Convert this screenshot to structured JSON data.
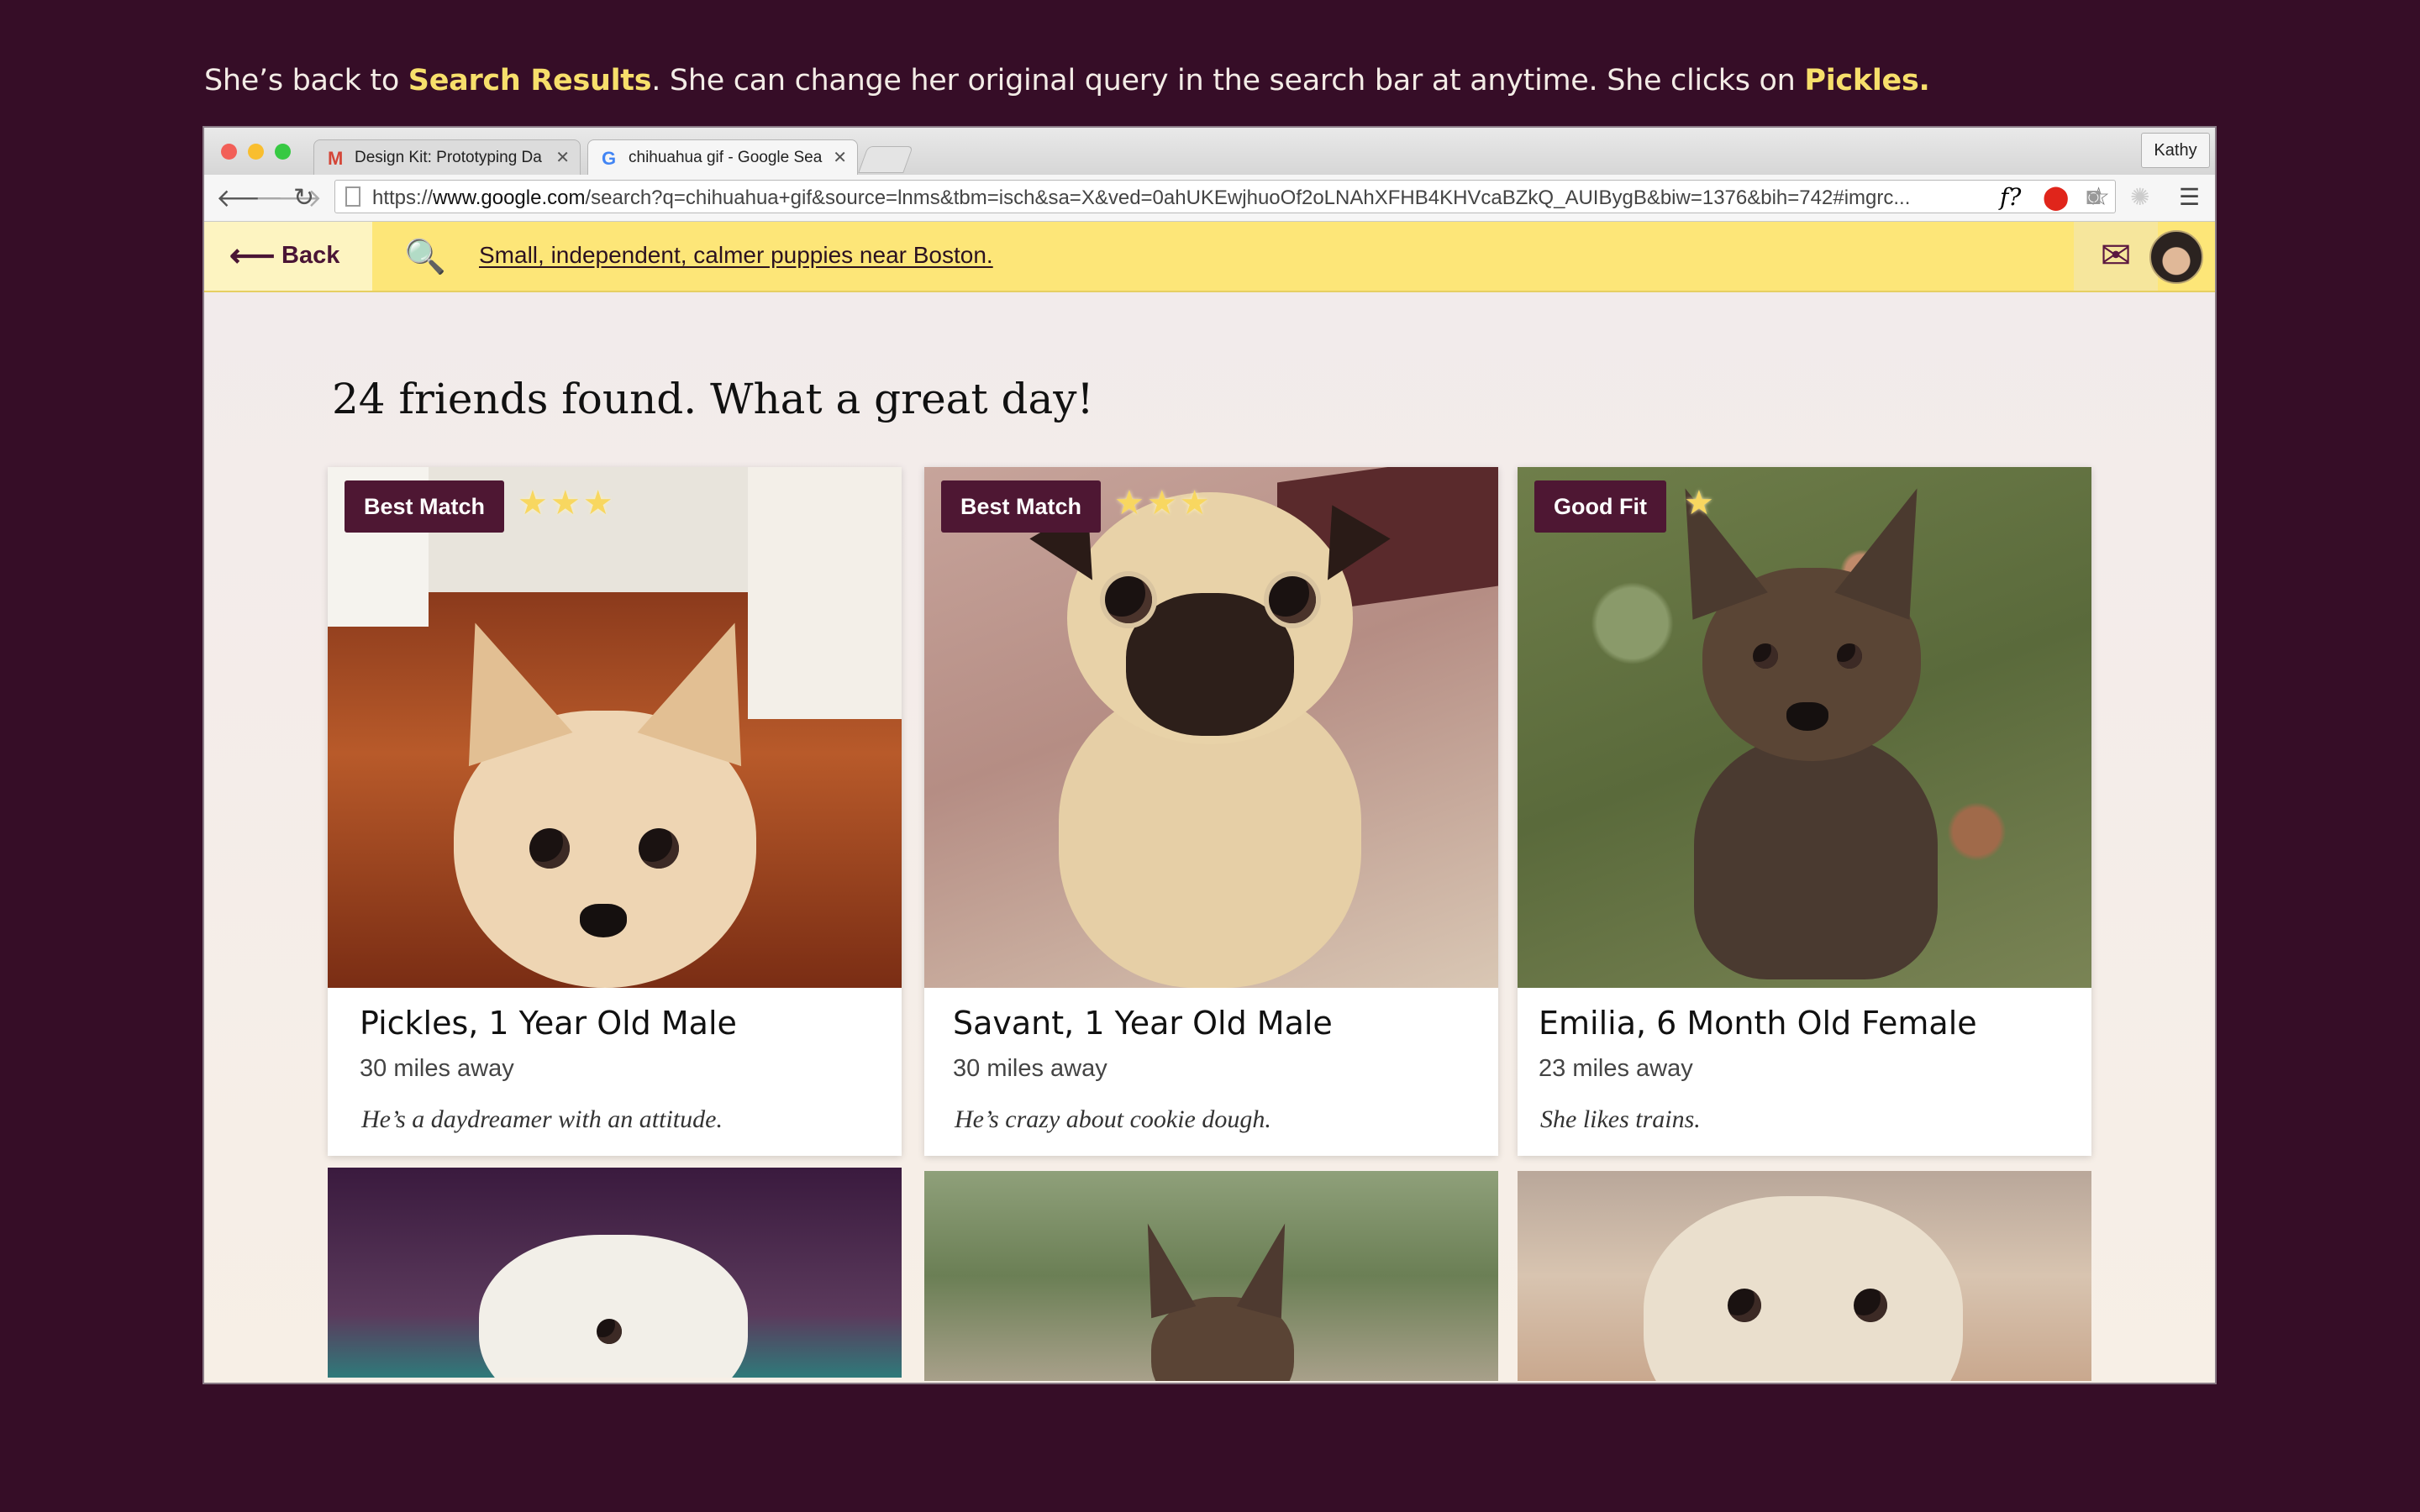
{
  "caption": {
    "part1": "She’s back to ",
    "highlight1": "Search Results",
    "part2": ". She can change her original query in the search bar at anytime. She clicks on ",
    "highlight2": "Pickles."
  },
  "browser": {
    "tabs": [
      {
        "label": "Design Kit: Prototyping Da",
        "favicon": "gmail-icon",
        "active": false
      },
      {
        "label": "chihuahua gif - Google Sea",
        "favicon": "google-icon",
        "active": true
      }
    ],
    "profile": "Kathy",
    "url_prefix": "https://",
    "url_domain": "www.google.com",
    "url_rest": "/search?q=chihuahua+gif&source=lnms&tbm=isch&sa=X&ved=0ahUKEwjhuoOf2oLNAhXFHB4KHVcaBZkQ_AUIBygB&biw=1376&bih=742#imgrc...",
    "ext_f_label": "f?"
  },
  "app": {
    "back_label": "Back",
    "query": "Small, independent, calmer puppies near Boston.",
    "heading": "24 friends found. What a great day!"
  },
  "cards": [
    {
      "badge": "Best Match",
      "stars": 3,
      "title": "Pickles, 1 Year Old Male",
      "distance": "30 miles away",
      "description": "He’s a daydreamer with an attitude."
    },
    {
      "badge": "Best Match",
      "stars": 3,
      "title": "Savant, 1 Year Old Male",
      "distance": "30 miles away",
      "description": "He’s crazy about cookie dough."
    },
    {
      "badge": "Good Fit",
      "stars": 1,
      "title": "Emilia, 6 Month Old Female",
      "distance": "23 miles away",
      "description": "She likes trains."
    }
  ],
  "colors": {
    "page_bg": "#360d27",
    "caption_highlight": "#f7df6b",
    "header_yellow": "#fde678",
    "badge_bg": "#4e1733"
  }
}
